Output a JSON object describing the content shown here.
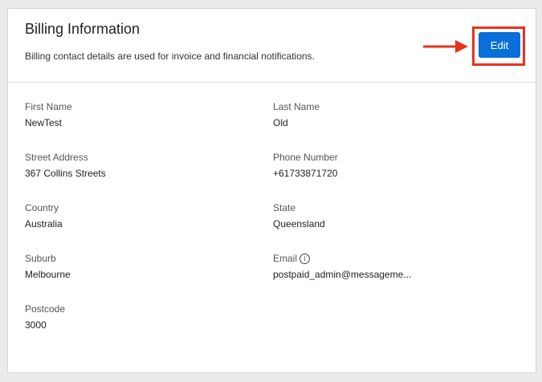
{
  "header": {
    "title": "Billing Information",
    "subtitle": "Billing contact details are used for invoice and financial notifications.",
    "edit_label": "Edit"
  },
  "fields": {
    "first_name": {
      "label": "First Name",
      "value": "NewTest"
    },
    "last_name": {
      "label": "Last Name",
      "value": "Old"
    },
    "street_address": {
      "label": "Street Address",
      "value": "367 Collins Streets"
    },
    "phone_number": {
      "label": "Phone Number",
      "value": "+61733871720"
    },
    "country": {
      "label": "Country",
      "value": "Australia"
    },
    "state": {
      "label": "State",
      "value": "Queensland"
    },
    "suburb": {
      "label": "Suburb",
      "value": "Melbourne"
    },
    "email": {
      "label": "Email",
      "value": "postpaid_admin@messageme..."
    },
    "postcode": {
      "label": "Postcode",
      "value": "3000"
    }
  },
  "colors": {
    "accent": "#0a6fd8",
    "highlight": "#e8321c"
  },
  "icons": {
    "email_info": "info-icon",
    "annotation": "arrow-right-icon"
  }
}
